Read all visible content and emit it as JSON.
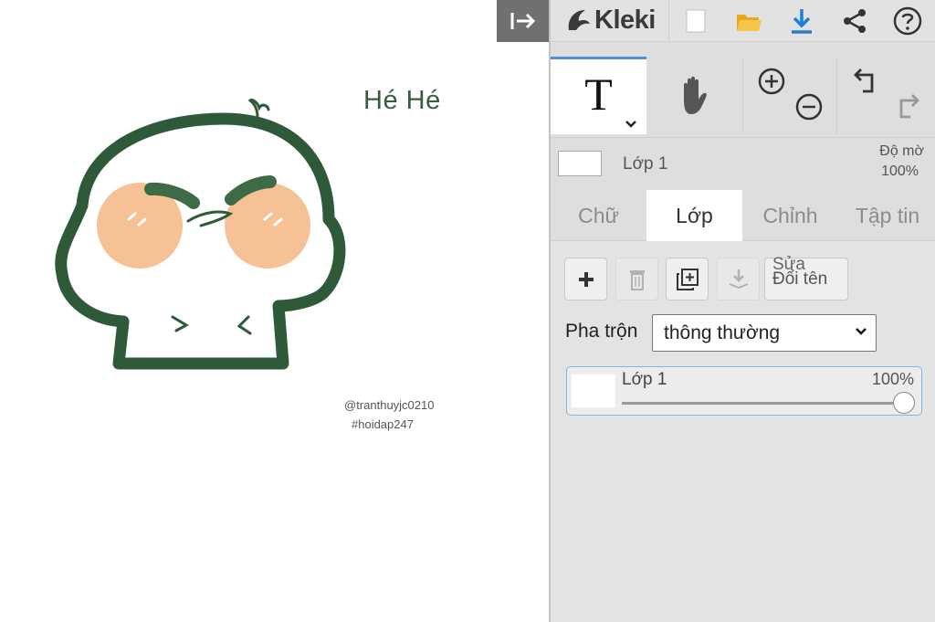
{
  "canvas": {
    "text_main": "Hé Hé",
    "handle": "@tranthuyjc0210",
    "hashtag": "#hoidap247"
  },
  "app": {
    "name": "Kleki"
  },
  "toolbar": {
    "text_tool_glyph": "T"
  },
  "layer": {
    "name": "Lớp 1",
    "opacity_label": "Độ mờ",
    "opacity_value": "100%"
  },
  "tabs": [
    {
      "label": "Chữ"
    },
    {
      "label": "Lớp"
    },
    {
      "label": "Chỉnh"
    },
    {
      "label": "Tập tin"
    }
  ],
  "layers_panel": {
    "rename_ghost": "Sửa",
    "rename_label": "Đổi tên",
    "blend_label": "Pha trộn",
    "blend_value": "thông thường",
    "items": [
      {
        "name": "Lớp 1",
        "opacity": "100%"
      }
    ]
  },
  "colors": {
    "accent": "#4a90d9",
    "doodle_green": "#2f5a3a",
    "cheek_orange": "#f7c196",
    "download_blue": "#1e7fd9",
    "folder_yellow": "#f2b632"
  }
}
